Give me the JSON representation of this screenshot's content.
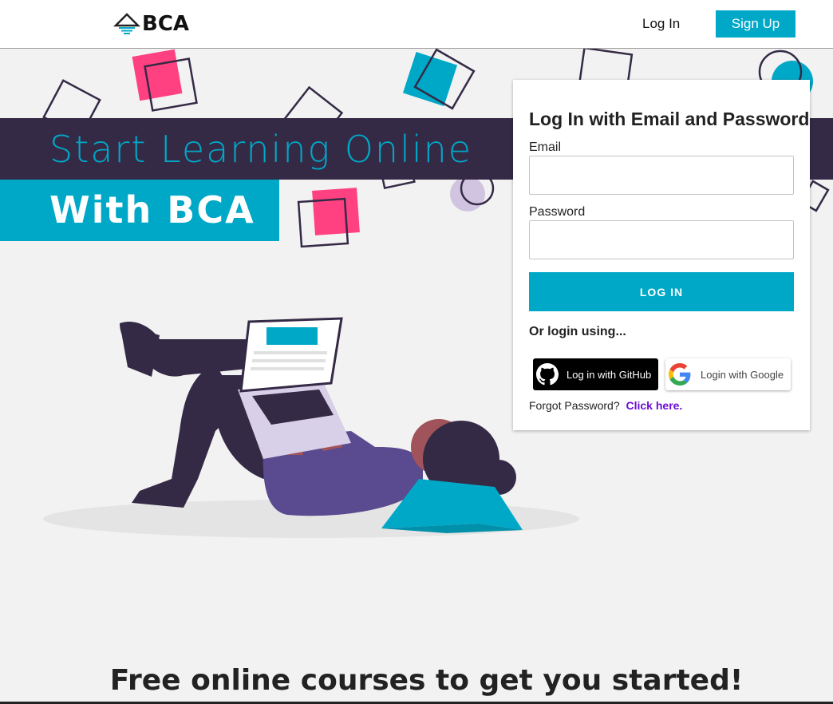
{
  "navbar": {
    "logo_text": "BCA",
    "login_label": "Log In",
    "signup_label": "Sign Up"
  },
  "hero": {
    "headline_line1": "Start Learning Online",
    "headline_line2": "With BCA"
  },
  "login_card": {
    "title": "Log In with Email and Password",
    "email_label": "Email",
    "email_value": "",
    "password_label": "Password",
    "password_value": "",
    "login_button": "LOG IN",
    "or_text": "Or login using...",
    "github_button": "Log in with GitHub",
    "google_button": "Login with Google",
    "forgot_text": "Forgot Password?",
    "forgot_link": "Click here."
  },
  "courses": {
    "subtitle": "Free online courses to get you started!"
  },
  "colors": {
    "accent": "#00a8c8",
    "dark": "#352a46",
    "pink": "#ff4081",
    "link": "#6a0dd6"
  }
}
